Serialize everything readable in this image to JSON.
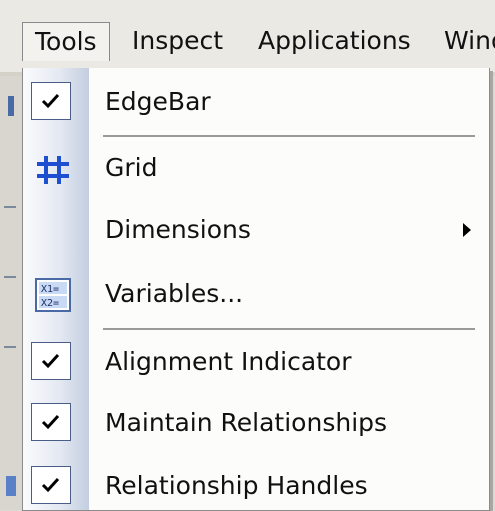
{
  "menubar": {
    "items": [
      {
        "label": "Tools"
      },
      {
        "label": "Inspect"
      },
      {
        "label": "Applications"
      },
      {
        "label": "Wind"
      }
    ]
  },
  "menu": {
    "items": [
      {
        "label": "EdgeBar",
        "checked": true,
        "icon": "checkmark-icon"
      },
      {
        "label": "Grid",
        "icon": "grid-icon"
      },
      {
        "label": "Dimensions",
        "submenu": true
      },
      {
        "label": "Variables...",
        "icon": "variables-icon"
      },
      {
        "label": "Alignment Indicator",
        "checked": true,
        "icon": "checkmark-icon"
      },
      {
        "label": "Maintain Relationships",
        "checked": true,
        "icon": "checkmark-icon"
      },
      {
        "label": "Relationship Handles",
        "checked": true,
        "icon": "checkmark-icon"
      }
    ]
  },
  "colors": {
    "menu_bg": "#fcfcfb",
    "gutter_dark": "#c4cee0",
    "grid_icon": "#1e4fd0",
    "check_border": "#4a5d86"
  }
}
